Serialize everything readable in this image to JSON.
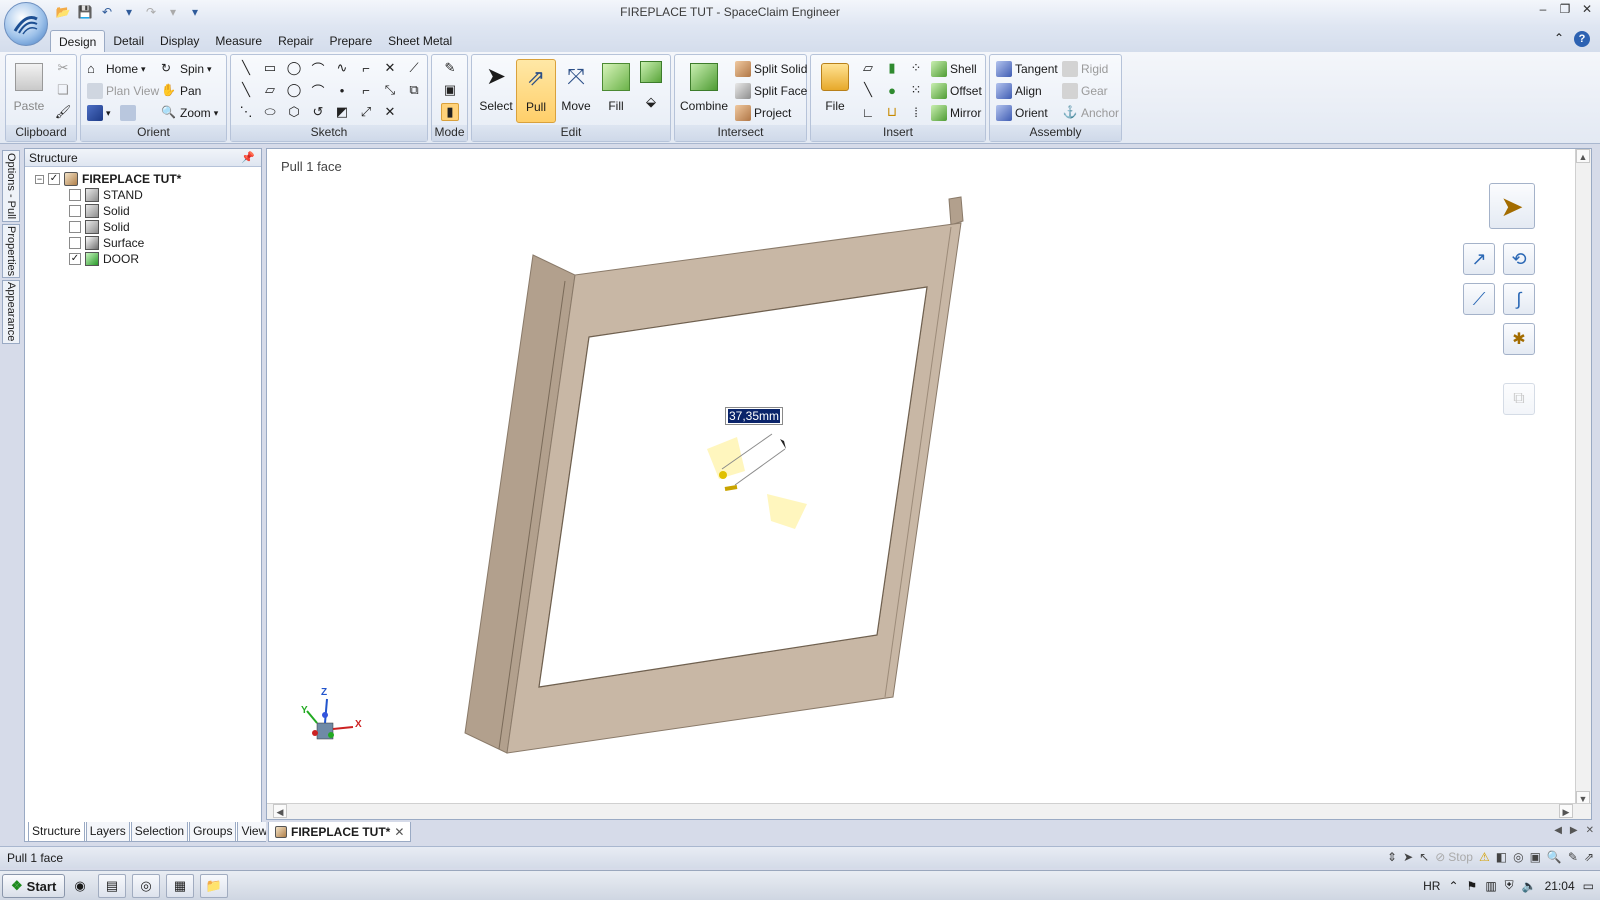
{
  "window": {
    "title": "FIREPLACE TUT - SpaceClaim Engineer"
  },
  "ribbon_tabs": [
    "Design",
    "Detail",
    "Display",
    "Measure",
    "Repair",
    "Prepare",
    "Sheet Metal"
  ],
  "ribbon": {
    "clipboard": {
      "label": "Clipboard",
      "paste": "Paste"
    },
    "orient": {
      "label": "Orient",
      "home": "Home",
      "plan_view": "Plan View",
      "spin": "Spin",
      "pan": "Pan",
      "zoom": "Zoom"
    },
    "sketch": {
      "label": "Sketch"
    },
    "mode": {
      "label": "Mode"
    },
    "edit": {
      "label": "Edit",
      "select": "Select",
      "pull": "Pull",
      "move": "Move",
      "fill": "Fill"
    },
    "intersect": {
      "label": "Intersect",
      "combine": "Combine",
      "split_solid": "Split Solid",
      "split_face": "Split Face",
      "project": "Project"
    },
    "insert": {
      "label": "Insert",
      "file": "File",
      "shell": "Shell",
      "offset": "Offset",
      "mirror": "Mirror"
    },
    "assembly": {
      "label": "Assembly",
      "tangent": "Tangent",
      "align": "Align",
      "orient": "Orient",
      "rigid": "Rigid",
      "gear": "Gear",
      "anchor": "Anchor"
    }
  },
  "side_tabs": [
    "Options - Pull",
    "Properties",
    "Appearance"
  ],
  "structure": {
    "title": "Structure",
    "root": "FIREPLACE TUT*",
    "items": [
      {
        "label": "STAND",
        "checked": false
      },
      {
        "label": "Solid",
        "checked": false
      },
      {
        "label": "Solid",
        "checked": false
      },
      {
        "label": "Surface",
        "checked": false
      },
      {
        "label": "DOOR",
        "checked": true
      }
    ],
    "bottom_tabs": [
      "Structure",
      "Layers",
      "Selection",
      "Groups",
      "Views"
    ]
  },
  "viewport": {
    "title": "Pull 1 face",
    "dimension": "37,35mm",
    "axis_labels": {
      "x": "X",
      "y": "Y",
      "z": "Z"
    }
  },
  "document_tab": "FIREPLACE TUT*",
  "status": {
    "text": "Pull 1 face",
    "stop": "Stop"
  },
  "taskbar": {
    "start": "Start",
    "lang": "HR",
    "time": "21:04"
  },
  "colors": {
    "frame_face": "#c8b7a5",
    "frame_side": "#b2a08d",
    "frame_edge": "#8a7a69",
    "pull_arrow": "#fff4b3",
    "accent": "#ffd27a"
  }
}
